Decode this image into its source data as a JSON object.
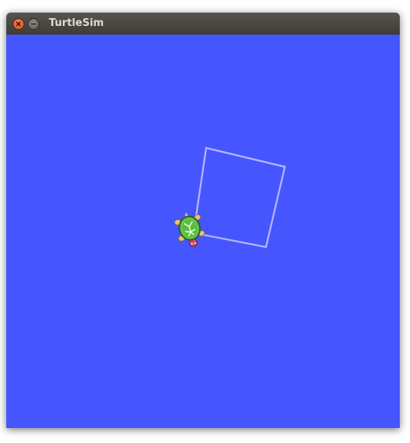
{
  "window": {
    "title": "TurtleSim",
    "close_icon": "close-icon",
    "minimize_icon": "minimize-icon"
  },
  "canvas": {
    "background_color": "#4556ff",
    "pen_color": "#b3b8ff",
    "shell_color": "#5dbb3f"
  }
}
